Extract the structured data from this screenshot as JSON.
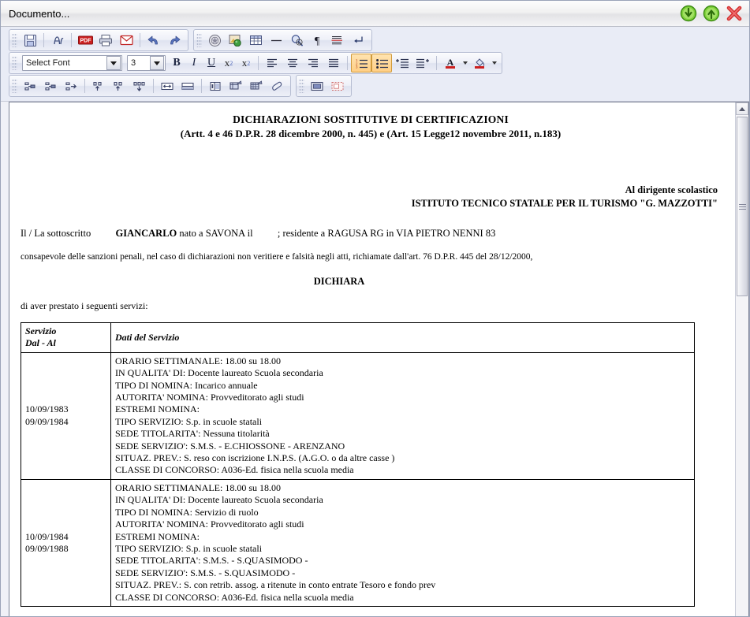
{
  "window": {
    "title": "Documento...",
    "buttons": [
      {
        "name": "download-icon",
        "label": "Scarica",
        "color": "#4caf1e"
      },
      {
        "name": "upload-icon",
        "label": "Carica",
        "color": "#4caf1e"
      },
      {
        "name": "close-icon",
        "label": "Chiudi",
        "color": "#d32f2f"
      }
    ]
  },
  "toolbar": {
    "row1": {
      "group1": [
        "save-icon",
        "find-icon",
        "pdf-icon",
        "print-icon",
        "mail-icon",
        "undo-icon",
        "redo-icon"
      ],
      "group2": [
        "emblem-icon",
        "insert-image-icon",
        "insert-table-icon",
        "horizontal-rule-icon",
        "search-zoom-icon",
        "paragraph-mark-icon",
        "page-break-icon",
        "line-break-icon"
      ]
    },
    "row2": {
      "font_select": {
        "value": "Select Font",
        "placeholder": "Select Font"
      },
      "size_select": {
        "value": "3"
      },
      "bold_label": "B",
      "italic_label": "I",
      "underline_label": "U",
      "superscript_label": "x",
      "superscript_sup": "2",
      "subscript_label": "x",
      "subscript_sub": "2",
      "align": [
        "align-left-icon",
        "align-center-icon",
        "align-right-icon",
        "align-justify-icon"
      ],
      "lists": [
        "ordered-list-icon",
        "unordered-list-icon"
      ],
      "indent": [
        "decrease-indent-icon",
        "increase-indent-icon"
      ],
      "text_color_label": "A",
      "highlight_color_label": "fill"
    },
    "row3": {
      "group1": [
        "insert-row-above-icon",
        "insert-row-below-icon",
        "delete-row-icon",
        "insert-column-left-icon",
        "insert-column-right-icon",
        "delete-column-icon",
        "merge-cells-horizontal-icon",
        "split-cells-icon",
        "cell-properties-icon",
        "table-properties-icon",
        "table-style-icon",
        "erase-formatting-icon"
      ],
      "group2": [
        "show-borders-icon",
        "hide-borders-icon"
      ]
    }
  },
  "document": {
    "heading1": "DICHIARAZIONI SOSTITUTIVE DI CERTIFICAZIONI",
    "heading2": "(Artt. 4 e 46 D.P.R. 28 dicembre 2000, n. 445) e (Art. 15 Legge12 novembre 2011, n.183)",
    "addressee_line1": "Al dirigente scolastico",
    "addressee_line2": "ISTITUTO TECNICO STATALE PER IL TURISMO \"G. MAZZOTTI\"",
    "subscriber_prefix": "Il / La sottoscritto",
    "subscriber_name": "GIANCARLO",
    "subscriber_born": "nato a SAVONA il",
    "subscriber_residence": "; residente a RAGUSA RG in VIA PIETRO NENNI 83",
    "awareness": "consapevole delle sanzioni penali, nel caso di dichiarazioni non veritiere e falsità negli atti, richiamate dall'art. 76 D.P.R. 445 del 28/12/2000,",
    "declares": "DICHIARA",
    "services_intro": "di aver prestato i seguenti servizi:",
    "table": {
      "headers": {
        "col1_line1": "Servizio",
        "col1_line2": "Dal - Al",
        "col2": "Dati del Servizio"
      },
      "rows": [
        {
          "date_from": "10/09/1983",
          "date_to": "09/09/1984",
          "details": [
            "ORARIO SETTIMANALE: 18.00 su 18.00",
            "IN QUALITA' DI: Docente laureato Scuola secondaria",
            "TIPO DI NOMINA: Incarico annuale",
            "AUTORITA' NOMINA: Provveditorato agli studi",
            "ESTREMI NOMINA:",
            "TIPO SERVIZIO: S.p. in scuole statali",
            "SEDE TITOLARITA': Nessuna titolarità",
            "SEDE SERVIZIO': S.M.S. - E.CHIOSSONE - ARENZANO",
            "SITUAZ. PREV.: S. reso con iscrizione I.N.P.S. (A.G.O. o da altre casse )",
            "CLASSE DI CONCORSO: A036-Ed. fisica nella scuola media"
          ]
        },
        {
          "date_from": "10/09/1984",
          "date_to": "09/09/1988",
          "details": [
            "ORARIO SETTIMANALE: 18.00 su 18.00",
            "IN QUALITA' DI: Docente laureato Scuola secondaria",
            "TIPO DI NOMINA: Servizio di ruolo",
            "AUTORITA' NOMINA: Provveditorato agli studi",
            "ESTREMI NOMINA:",
            "TIPO SERVIZIO: S.p. in scuole statali",
            "SEDE TITOLARITA': S.M.S. - S.QUASIMODO -",
            "SEDE SERVIZIO': S.M.S. - S.QUASIMODO -",
            "SITUAZ. PREV.: S. con retrib. assog. a ritenute in conto entrate Tesoro e fondo prev",
            "CLASSE DI CONCORSO: A036-Ed. fisica nella scuola media"
          ]
        }
      ]
    }
  },
  "scrollbar": {
    "up_arrow": "scroll-up-icon"
  }
}
